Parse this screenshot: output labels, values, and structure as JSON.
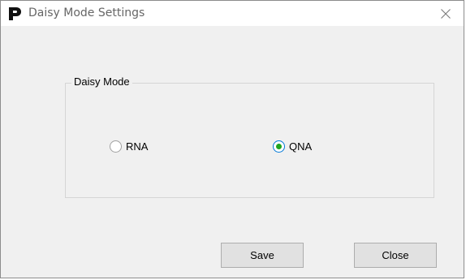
{
  "window": {
    "title": "Daisy Mode Settings",
    "logo_letter": "P"
  },
  "group": {
    "label": "Daisy Mode"
  },
  "radios": [
    {
      "label": "RNA",
      "checked": false
    },
    {
      "label": "QNA",
      "checked": true
    }
  ],
  "buttons": {
    "save_label": "Save",
    "close_label": "Close"
  },
  "colors": {
    "radio_selected_dot": "#1fa51f",
    "radio_focus_ring": "#0078d7"
  },
  "icons": {
    "logo": "app-logo-icon",
    "close": "close-icon"
  }
}
